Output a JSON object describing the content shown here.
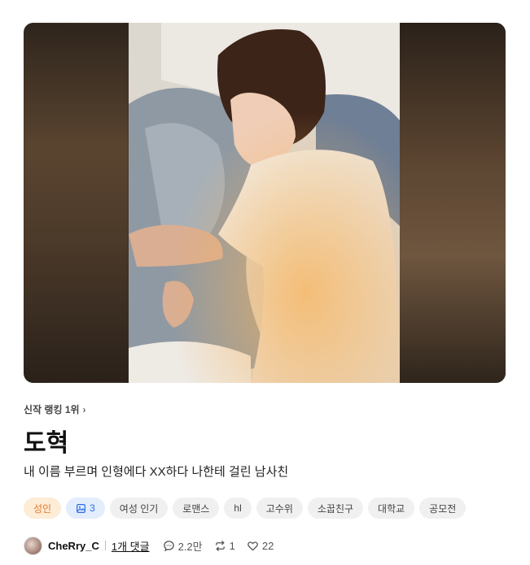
{
  "rank_label": "신작 랭킹 1위",
  "title": "도혁",
  "subtitle": "내 이름 부르며 인형에다 XX하다 나한테 걸린 남사친",
  "tags": {
    "adult": "성인",
    "images_count": "3",
    "t1": "여성 인기",
    "t2": "로맨스",
    "t3": "hl",
    "t4": "고수위",
    "t5": "소꿉친구",
    "t6": "대학교",
    "t7": "공모전"
  },
  "meta": {
    "author": "CheRry_C",
    "comments": "1개 댓글",
    "views": "2.2만",
    "reposts": "1",
    "likes": "22"
  },
  "icons": [
    "chevron-right-icon",
    "image-icon",
    "chat-icon",
    "repost-icon",
    "heart-icon"
  ],
  "colors": {
    "adult_tag_text": "#e07b2a",
    "adult_tag_bg": "#fdecd6",
    "image_tag_text": "#2e6ee6",
    "image_tag_bg": "#e3edfc"
  }
}
